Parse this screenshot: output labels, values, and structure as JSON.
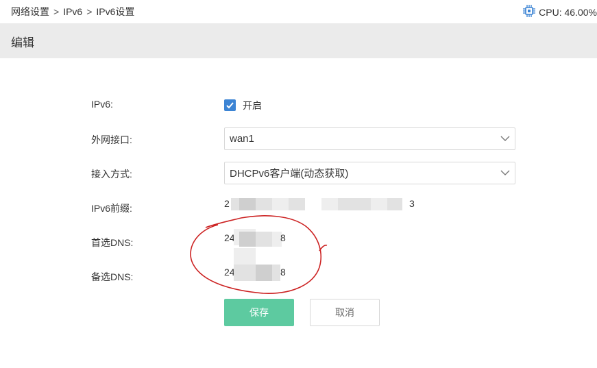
{
  "breadcrumb": {
    "items": [
      "网络设置",
      "IPv6",
      "IPv6设置"
    ],
    "separator": ">"
  },
  "cpu": {
    "icon": "cpu-chip-icon",
    "label": "CPU: 46.00%"
  },
  "edit_title": "编辑",
  "form": {
    "ipv6_label": "IPv6:",
    "ipv6_enabled": true,
    "ipv6_checkbox_text": "开启",
    "wan_label": "外网接口:",
    "wan_value": "wan1",
    "access_label": "接入方式:",
    "access_value": "DHCPv6客户端(动态获取)",
    "prefix_label": "IPv6前缀:",
    "prefix_start": "2",
    "prefix_end": "3",
    "dns1_label": "首选DNS:",
    "dns1_start": "24",
    "dns1_end": "8",
    "dns2_label": "备选DNS:",
    "dns2_start": "24",
    "dns2_end": "8"
  },
  "buttons": {
    "save": "保存",
    "cancel": "取消"
  },
  "colors": {
    "accent_blue": "#3c84d4",
    "save_green": "#5dcaa0",
    "header_gray": "#ebebeb",
    "annotation_red": "#cc2222"
  }
}
